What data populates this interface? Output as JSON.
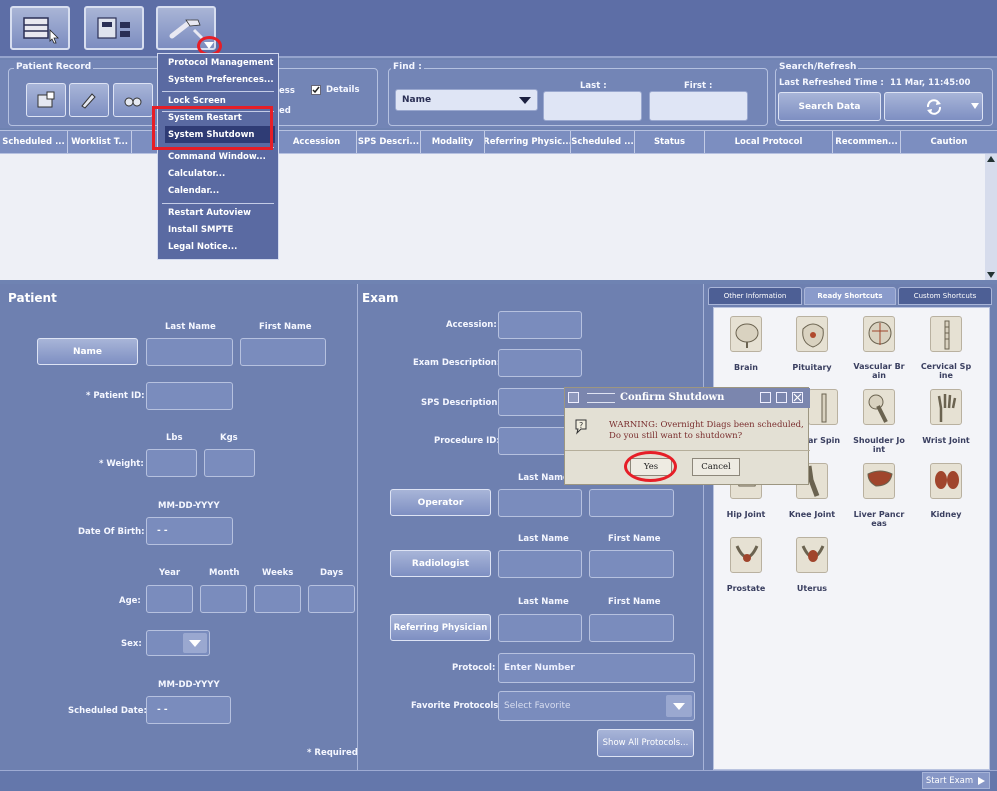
{
  "toolbar": {
    "buttons": [
      {
        "icon": "patient-list-icon"
      },
      {
        "icon": "network-icon"
      },
      {
        "icon": "tools-icon"
      }
    ]
  },
  "patient_record": {
    "label": "Patient Record",
    "details_label": "Details",
    "partial_labels": [
      "ess",
      "ed"
    ]
  },
  "find": {
    "label": "Find :",
    "selected": "Name",
    "last_label": "Last :",
    "first_label": "First :"
  },
  "search_refresh": {
    "label": "Search/Refresh",
    "last_refreshed_label": "Last Refreshed Time :",
    "last_refreshed_value": "11 Mar, 11:45:00",
    "search_button": "Search Data"
  },
  "table": {
    "columns": [
      "Scheduled ...",
      "Worklist T...",
      "Accession",
      "SPS Descri...",
      "Modality",
      "Referring Physic...",
      "Scheduled ...",
      "Status",
      "Local Protocol",
      "Recommen...",
      "Caution"
    ]
  },
  "menu": {
    "items": [
      "Protocol Management",
      "System Preferences...",
      "Lock Screen",
      "System Restart",
      "System Shutdown",
      "Command Window...",
      "Calculator...",
      "Calendar...",
      "Restart Autoview",
      "Install SMPTE",
      "Legal Notice..."
    ]
  },
  "patient": {
    "title": "Patient",
    "last_name_header": "Last Name",
    "first_name_header": "First Name",
    "name_button": "Name",
    "patient_id_label": "* Patient ID:",
    "lbs_label": "Lbs",
    "kgs_label": "Kgs",
    "weight_label": "* Weight:",
    "dob_format": "MM-DD-YYYY",
    "dob_label": "Date Of Birth:",
    "dob_value": "- -",
    "year_label": "Year",
    "month_label": "Month",
    "weeks_label": "Weeks",
    "days_label": "Days",
    "age_label": "Age:",
    "sex_label": "Sex:",
    "sched_format": "MM-DD-YYYY",
    "scheduled_date_label": "Scheduled Date:",
    "scheduled_date_value": "- -",
    "required_note": "* Required"
  },
  "exam": {
    "title": "Exam",
    "accession_label": "Accession:",
    "exam_description_label": "Exam Description:",
    "sps_description_label": "SPS Description:",
    "procedure_id_label": "Procedure ID:",
    "operator_button": "Operator",
    "radiologist_button": "Radiologist",
    "referring_button": "Referring Physician",
    "last_name_header": "Last Name",
    "first_name_header": "First Name",
    "protocol_label": "Protocol:",
    "protocol_placeholder": "Enter Number",
    "favorite_label": "Favorite Protocols:",
    "favorite_placeholder": "Select Favorite",
    "show_all_button": "Show All Protocols..."
  },
  "shortcuts": {
    "tabs": [
      "Other Information",
      "Ready Shortcuts",
      "Custom Shortcuts"
    ],
    "items": [
      "Brain",
      "Pituitary",
      "Vascular Br ain",
      "Cervical Sp ine",
      "ar Spin",
      "Shoulder Jo int",
      "Wrist Joint",
      "Hip Joint",
      "Knee Joint",
      "Liver Pancr eas",
      "Kidney",
      "Prostate",
      "Uterus"
    ]
  },
  "dialog": {
    "title": "Confirm Shutdown",
    "message_line1": "WARNING:  Overnight Diags been scheduled,",
    "message_line2": "Do you still want to shutdown?",
    "yes_button": "Yes",
    "cancel_button": "Cancel"
  },
  "status_bar": {
    "start_exam": "Start Exam"
  },
  "colors": {
    "background": "#6f83b2",
    "menu": "#5a6aa2",
    "highlight": "#e61e27",
    "dialog": "#e3e0d4"
  }
}
